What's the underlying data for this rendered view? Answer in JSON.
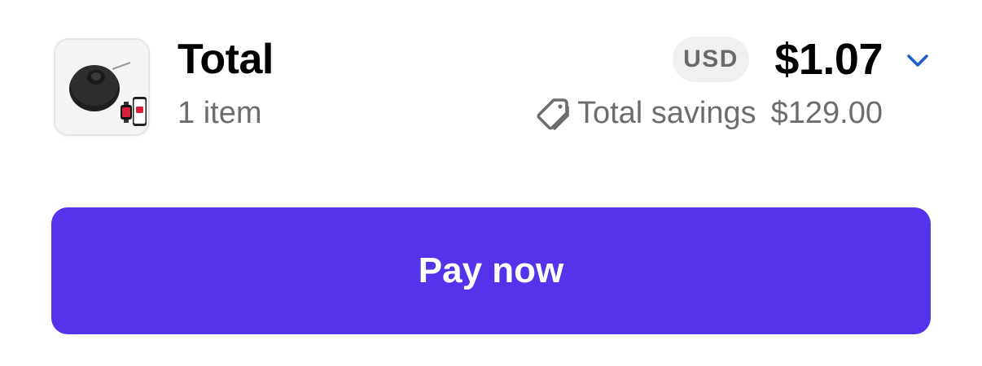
{
  "summary": {
    "title": "Total",
    "item_count": "1 item",
    "product_image": "robot-vacuum-with-phone-and-watch"
  },
  "price": {
    "currency": "USD",
    "amount": "$1.07",
    "expand_icon": "chevron-down-icon"
  },
  "savings": {
    "icon": "tag-icon",
    "label": "Total savings",
    "value": "$129.00"
  },
  "action": {
    "pay_label": "Pay now"
  },
  "colors": {
    "accent": "#5433eb",
    "chevron": "#1f5fd1",
    "muted_text": "#6d6d6d",
    "badge_bg": "#f0f0f0"
  }
}
